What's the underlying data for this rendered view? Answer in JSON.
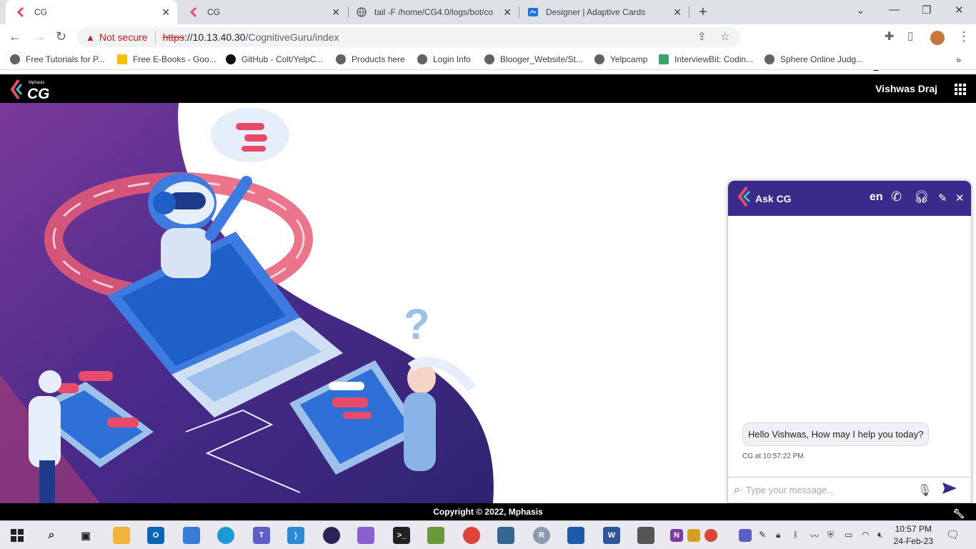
{
  "browser": {
    "tabs": [
      {
        "title": "CG",
        "active": true
      },
      {
        "title": "CG",
        "active": false
      },
      {
        "title": "tail -F /home/CG4.0/logs/bot/co",
        "active": false
      },
      {
        "title": "Designer | Adaptive Cards",
        "active": false
      }
    ],
    "security_label": "Not secure",
    "url_scheme": "https",
    "url_host": "://10.13.40.30",
    "url_path": "/CognitiveGuru/index",
    "bookmarks": [
      "Free Tutorials for P...",
      "Free E-Books - Goo...",
      "GitHub - Colt/YelpC...",
      "Products here",
      "Login Info",
      "Blooger_Website/St...",
      "Yelpcamp",
      "InterviewBit: Codin...",
      "Sphere Online Judg..."
    ],
    "extension_badge": "0"
  },
  "app": {
    "logo_small": "Mphasis",
    "logo_text": "CG",
    "user_name": "Vishwas Draj",
    "footer_text": "Copyright © 2022, Mphasis"
  },
  "chat": {
    "title": "Ask CG",
    "language": "en",
    "bot_message": "Hello Vishwas, How may I help you today?",
    "message_meta": "CG at 10:57:22 PM",
    "input_placeholder": "Type your message..."
  },
  "taskbar": {
    "time": "10:57 PM",
    "date": "24-Feb-23"
  },
  "colors": {
    "header_bg": "#000000",
    "chat_header": "#3a2a8c",
    "illustration_purple": "#4a2a8a",
    "accent_red": "#e84a6a"
  }
}
